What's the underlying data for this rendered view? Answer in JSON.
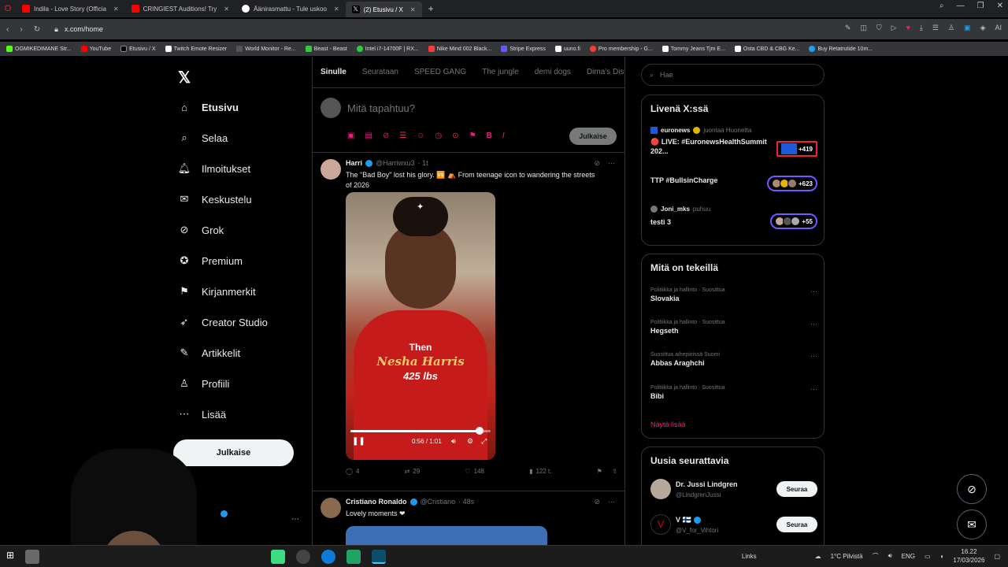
{
  "browser": {
    "tabs": [
      {
        "title": "Indila - Love Story (Officia",
        "color": "#ff0000",
        "active": false
      },
      {
        "title": "CRINGIEST Auditions! Try",
        "color": "#ff0000",
        "active": false
      },
      {
        "title": "Äänirasmattu - Tule uskoo",
        "color": "#ffffff",
        "active": false
      },
      {
        "title": "(2) Etusivu / X",
        "color": "#000000",
        "active": true
      }
    ],
    "url": "x.com/home",
    "bookmarks": [
      {
        "label": "OGMIKEDIMANE Str...",
        "color": "#53fc18"
      },
      {
        "label": "YouTube",
        "color": "#ff0000"
      },
      {
        "label": "Etusivu / X",
        "color": "#000000"
      },
      {
        "label": "Twitch Emote Resizer",
        "color": "#ffffff"
      },
      {
        "label": "World Monitor - Re...",
        "color": "#555555"
      },
      {
        "label": "Beast - Beast",
        "color": "#2ecc40"
      },
      {
        "label": "Intel i7-14700F | RX...",
        "color": "#2ecc40"
      },
      {
        "label": "Nike Mind 002 Black...",
        "color": "#ff3b30"
      },
      {
        "label": "Stripe Express",
        "color": "#635bff"
      },
      {
        "label": "uuno.fi",
        "color": "#ffffff"
      },
      {
        "label": "Pro membership - G...",
        "color": "#ff3b30"
      },
      {
        "label": "Tommy Jeans Tjm E...",
        "color": "#ffffff"
      },
      {
        "label": "Osta CBD & CBG Ke...",
        "color": "#ffffff"
      },
      {
        "label": "Buy Retatrutide 10m...",
        "color": "#1da1f2"
      }
    ]
  },
  "nav": {
    "items": [
      {
        "label": "Etusivu",
        "icon": "home-icon",
        "glyph": "⌂"
      },
      {
        "label": "Selaa",
        "icon": "search-icon",
        "glyph": "⌕"
      },
      {
        "label": "Ilmoitukset",
        "icon": "bell-icon",
        "glyph": "♫"
      },
      {
        "label": "Keskustelu",
        "icon": "mail-icon",
        "glyph": "✉"
      },
      {
        "label": "Grok",
        "icon": "grok-icon",
        "glyph": "⊘"
      },
      {
        "label": "Premium",
        "icon": "verified-icon",
        "glyph": "✪"
      },
      {
        "label": "Kirjanmerkit",
        "icon": "bookmark-icon",
        "glyph": "⚑"
      },
      {
        "label": "Creator Studio",
        "icon": "rocket-icon",
        "glyph": "➶"
      },
      {
        "label": "Artikkelit",
        "icon": "article-icon",
        "glyph": "✎"
      },
      {
        "label": "Profiili",
        "icon": "profile-icon",
        "glyph": "♙"
      },
      {
        "label": "Lisää",
        "icon": "more-circle-icon",
        "glyph": "⋯"
      }
    ],
    "post_label": "Julkaise"
  },
  "main": {
    "tabs": [
      "Sinulle",
      "Seurataan",
      "SPEED GANG",
      "The jungle",
      "demi dogs",
      "Dima's Dist"
    ],
    "composer": {
      "placeholder": "Mitä tapahtuu?",
      "publish": "Julkaise"
    },
    "tweets": [
      {
        "name": "Harri",
        "handle": "@Harriwxu3",
        "time": "· 1t",
        "text": "The \"Bad Boy\" lost his glory. 🆚 ⛺ From teenage icon to wandering the streets of 2026",
        "video": {
          "cap1": "Then",
          "cap2": "Nesha Harris",
          "cap3": "425 lbs",
          "time": "0:56 / 1:01",
          "progress": 0.92
        },
        "stats": {
          "replies": "4",
          "reposts": "29",
          "likes": "148",
          "views": "122 t."
        }
      },
      {
        "name": "Cristiano Ronaldo",
        "handle": "@Cristiano",
        "time": "· 48s",
        "text": "Lovely moments ❤"
      }
    ]
  },
  "right": {
    "search_placeholder": "Hae",
    "live": {
      "title": "Livenä X:ssä",
      "rows": [
        {
          "host": "euronews",
          "meta": "juontaa Huonetta",
          "title": "🔴 LIVE: #EuronewsHealthSummit 202...",
          "count": "+419"
        },
        {
          "host": "",
          "meta": "",
          "title": "TTP #BullsinCharge",
          "count": "+623"
        },
        {
          "host": "Joni_mks",
          "meta": "puhuu",
          "title": "testi 3",
          "count": "+55"
        }
      ]
    },
    "trends": {
      "title": "Mitä on tekeillä",
      "items": [
        {
          "cat": "Politiikka ja hallinto · Suosittua",
          "name": "Slovakia"
        },
        {
          "cat": "Politiikka ja hallinto · Suosittua",
          "name": "Hegseth"
        },
        {
          "cat": "Suosittua aihepiirissä Suomi",
          "name": "Abbas Araghchi"
        },
        {
          "cat": "Politiikka ja hallinto · Suosittua",
          "name": "Bibi"
        }
      ],
      "show_more": "Näytä lisää"
    },
    "follow": {
      "title": "Uusia seurattavia",
      "items": [
        {
          "name": "Dr. Jussi Lindgren",
          "handle": "@LindgrenJussi",
          "button": "Seuraa"
        },
        {
          "name": "V 🇫🇮",
          "handle": "@V_for_Vihtori",
          "button": "Seuraa"
        }
      ]
    }
  },
  "taskbar": {
    "links": "Links",
    "weather": "1°C  Pilvistä",
    "lang": "ENG",
    "time": "16.22",
    "date": "17/03/2026"
  },
  "colors": {
    "accent": "#f91880",
    "bg": "#000000",
    "border": "#2f3336",
    "muted": "#71767b"
  }
}
